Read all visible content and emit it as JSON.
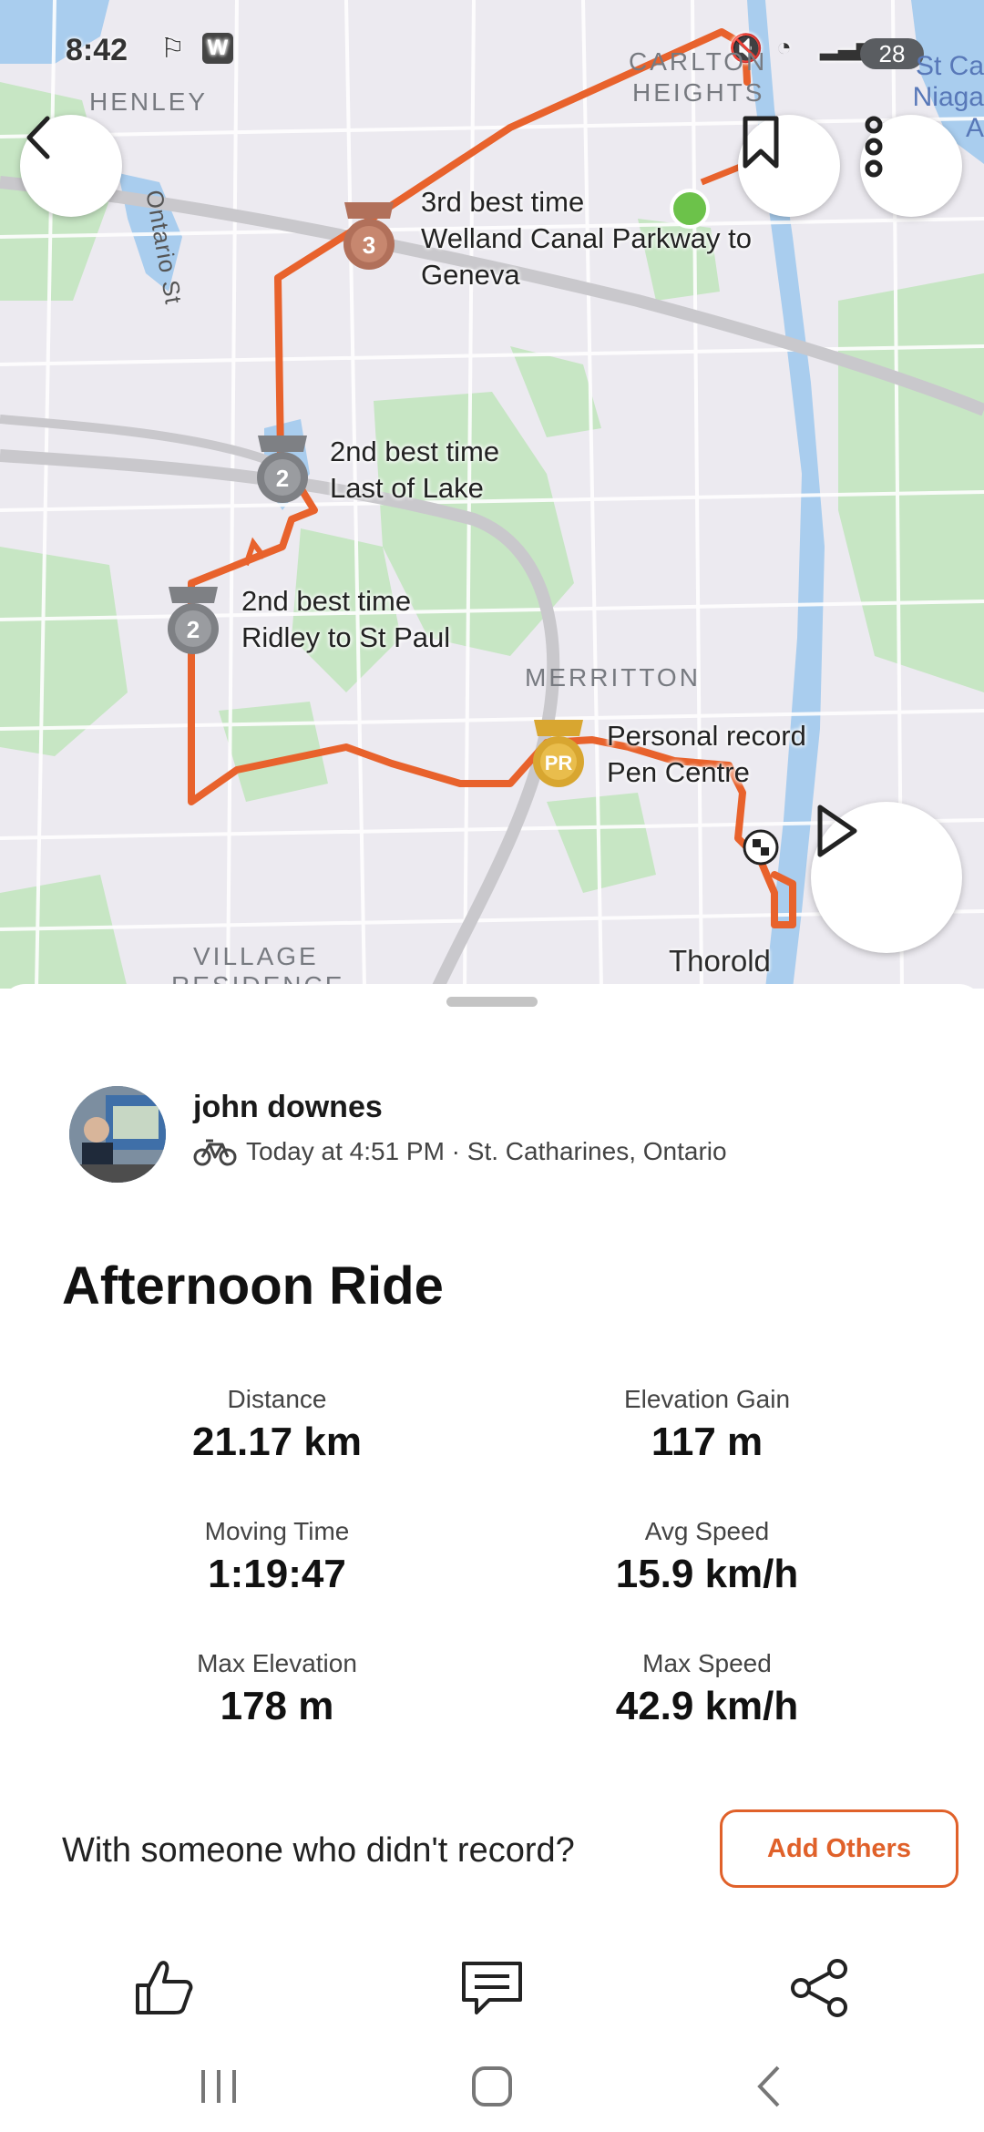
{
  "status_bar": {
    "time": "8:42",
    "battery": "28"
  },
  "map": {
    "place_labels": [
      "HENLEY",
      "CARLTON",
      "HEIGHTS",
      "MERRITTON",
      "VILLAGE",
      "RESIDENCE"
    ],
    "street_label": "Ontario St",
    "town_label": "Thorold",
    "edge_label_lines": [
      "St Ca",
      "Niaga",
      "A"
    ],
    "segments": [
      {
        "badge": "3",
        "line1": "3rd best time",
        "line2": "Welland Canal Parkway to",
        "line3": "Geneva"
      },
      {
        "badge": "2",
        "line1": "2nd best time",
        "line2": "Last of Lake"
      },
      {
        "badge": "2",
        "line1": "2nd best time",
        "line2": "Ridley to St Paul"
      },
      {
        "badge": "PR",
        "line1": "Personal record",
        "line2": "Pen Centre"
      }
    ],
    "route_color": "#e8622c",
    "icons": {
      "back": "back-arrow-icon",
      "bookmark": "bookmark-icon",
      "more": "more-vertical-icon",
      "play": "play-icon"
    }
  },
  "activity": {
    "athlete": "john downes",
    "meta": "Today at 4:51 PM · St. Catharines, Ontario",
    "title": "Afternoon Ride",
    "stats": [
      {
        "label": "Distance",
        "value": "21.17 km"
      },
      {
        "label": "Elevation Gain",
        "value": "117 m"
      },
      {
        "label": "Moving Time",
        "value": "1:19:47"
      },
      {
        "label": "Avg Speed",
        "value": "15.9 km/h"
      },
      {
        "label": "Max Elevation",
        "value": "178 m"
      },
      {
        "label": "Max Speed",
        "value": "42.9 km/h"
      }
    ],
    "prompt": "With someone who didn't record?",
    "add_button": "Add Others",
    "accent": "#e0612a"
  }
}
